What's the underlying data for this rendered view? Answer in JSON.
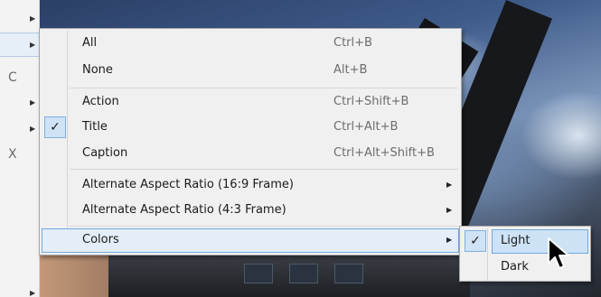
{
  "app_strip": {
    "letters": [
      "C",
      "X"
    ]
  },
  "menu": {
    "items": [
      {
        "label": "All",
        "shortcut": "Ctrl+B",
        "checked": false
      },
      {
        "label": "None",
        "shortcut": "Alt+B",
        "checked": false
      },
      {
        "label": "Action",
        "shortcut": "Ctrl+Shift+B",
        "checked": false
      },
      {
        "label": "Title",
        "shortcut": "Ctrl+Alt+B",
        "checked": true
      },
      {
        "label": "Caption",
        "shortcut": "Ctrl+Alt+Shift+B",
        "checked": false
      },
      {
        "label": "Alternate Aspect Ratio (16:9 Frame)",
        "shortcut": "",
        "submenu": true
      },
      {
        "label": "Alternate Aspect Ratio (4:3 Frame)",
        "shortcut": "",
        "submenu": true
      },
      {
        "label": "Colors",
        "shortcut": "",
        "submenu": true,
        "highlighted": true
      }
    ],
    "check_glyph": "✓",
    "arrow_glyph": "▶"
  },
  "colors_submenu": {
    "items": [
      {
        "label": "Light",
        "checked": true,
        "highlighted": true
      },
      {
        "label": "Dark",
        "checked": false
      }
    ]
  },
  "icons": {
    "check": "checkmark-icon",
    "submenu": "chevron-right-icon",
    "cursor": "mouse-pointer-icon"
  },
  "colors": {
    "highlight_fill": "#e3eef9",
    "highlight_border": "#6fa9dd",
    "check_fill": "#cfe2f6",
    "menu_bg": "#f0f0f0"
  }
}
